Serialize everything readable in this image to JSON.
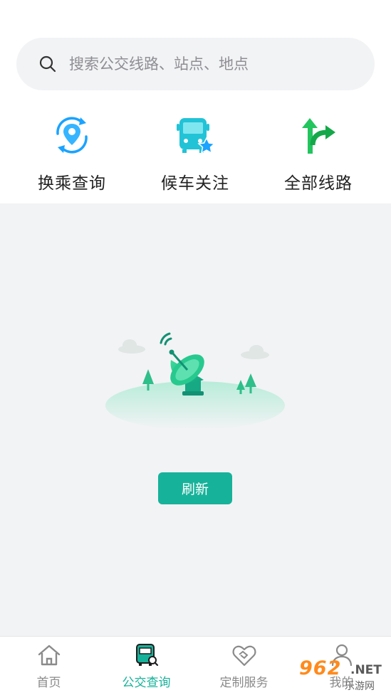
{
  "search": {
    "icon": "search-icon",
    "placeholder": "搜索公交线路、站点、地点"
  },
  "quick_actions": [
    {
      "label": "换乘查询",
      "icon": "transfer-location-icon"
    },
    {
      "label": "候车关注",
      "icon": "bus-star-icon"
    },
    {
      "label": "全部线路",
      "icon": "route-arrows-icon"
    }
  ],
  "empty_state": {
    "illustration": "satellite-dish-icon",
    "refresh_label": "刷新"
  },
  "tabbar": {
    "items": [
      {
        "label": "首页",
        "icon": "home-icon",
        "active": false
      },
      {
        "label": "公交查询",
        "icon": "bus-search-icon",
        "active": true
      },
      {
        "label": "定制服务",
        "icon": "handshake-heart-icon",
        "active": false
      },
      {
        "label": "我的",
        "icon": "user-icon",
        "active": false
      }
    ]
  },
  "watermark": {
    "brand_top": "962",
    "brand_net": ".NET",
    "brand_bottom": "乐游网"
  },
  "colors": {
    "accent": "#17b29a",
    "background": "#f2f3f5",
    "quick_blue": "#1aa3ff",
    "quick_green": "#22c55e"
  }
}
